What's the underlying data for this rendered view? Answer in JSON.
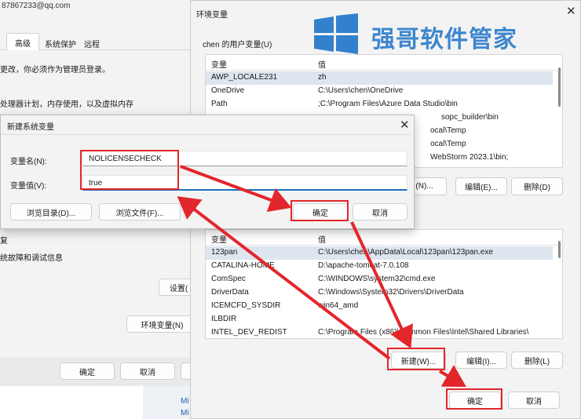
{
  "sys_props": {
    "email": "87867233@qq.com",
    "tabs": [
      "高级",
      "系统保护",
      "远程"
    ],
    "text_admin": "更改，你必须作为管理员登录。",
    "text_perf": "处理器计划，内存使用，以及虚拟内存",
    "text_startup": "复",
    "text_debug": "统故障和调试信息",
    "settings_btn": "设置(",
    "env_btn": "环境变量(N)",
    "ok": "确定",
    "cancel": "取消"
  },
  "env_dialog": {
    "title": "环境变量",
    "user_group": "chen 的用户变量(U)",
    "col_var": "变量",
    "col_val": "值",
    "user_vars": [
      {
        "name": "AWP_LOCALE231",
        "value": "zh"
      },
      {
        "name": "OneDrive",
        "value": "C:\\Users\\chen\\OneDrive"
      },
      {
        "name": "Path",
        "value": ";C:\\Program Files\\Azure Data Studio\\bin"
      },
      {
        "name": "",
        "value": "sopc_builder\\bin"
      },
      {
        "name": "",
        "value": "ocal\\Temp"
      },
      {
        "name": "",
        "value": "ocal\\Temp"
      },
      {
        "name": "",
        "value": "WebStorm 2023.1\\bin;"
      }
    ],
    "user_new": "(N)...",
    "user_edit": "编辑(E)...",
    "user_delete": "删除(D)",
    "sys_vars": [
      {
        "name": "123pan",
        "value": "C:\\Users\\chen\\AppData\\Local\\123pan\\123pan.exe"
      },
      {
        "name": "CATALINA-HOME",
        "value": "D:\\apache-tomcat-7.0.108"
      },
      {
        "name": "ComSpec",
        "value": "C:\\WINDOWS\\system32\\cmd.exe"
      },
      {
        "name": "DriverData",
        "value": "C:\\Windows\\System32\\Drivers\\DriverData"
      },
      {
        "name": "ICEMCFD_SYSDIR",
        "value": "win64_amd"
      },
      {
        "name": "ILBDIR",
        "value": ""
      },
      {
        "name": "INTEL_DEV_REDIST",
        "value": "C:\\Program Files (x86)\\Common Files\\Intel\\Shared Libraries\\"
      }
    ],
    "sys_new": "新建(W)...",
    "sys_edit": "编辑(I)...",
    "sys_delete": "删除(L)",
    "ok": "确定",
    "cancel": "取消"
  },
  "new_var": {
    "title": "新建系统变量",
    "name_label": "变量名(N):",
    "name_value": "NOLICENSECHECK",
    "value_label": "变量值(V):",
    "value_value": "true",
    "browse_dir": "浏览目录(D)...",
    "browse_file": "浏览文件(F)...",
    "ok": "确定",
    "cancel": "取消"
  },
  "watermark": {
    "text": "强哥软件管家"
  },
  "colors": {
    "highlight": "#e3262b",
    "brand": "#1e74c8"
  }
}
